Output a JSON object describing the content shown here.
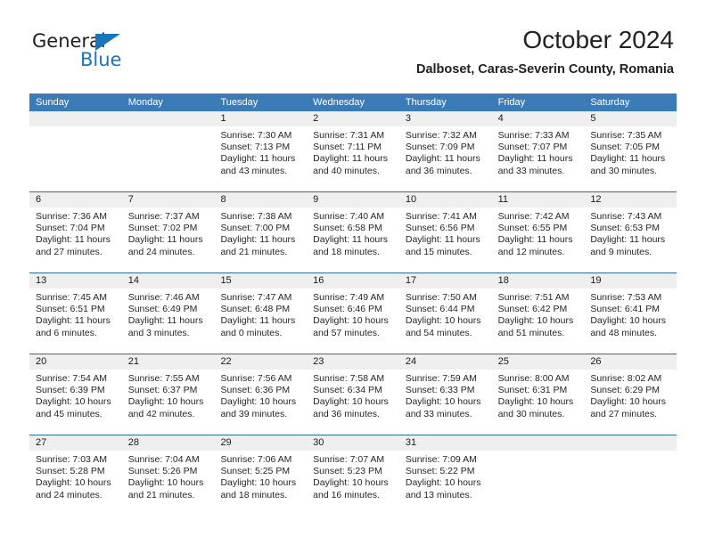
{
  "brand": {
    "name_top": "General",
    "name_bottom": "Blue",
    "accent_color": "#1b75bb"
  },
  "header": {
    "month_title": "October 2024",
    "location": "Dalboset, Caras-Severin County, Romania"
  },
  "calendar": {
    "header_bg": "#3b7cb8",
    "row_divider_color": "#2e6da4",
    "daynum_strip_color": "#efefef",
    "weekdays": [
      "Sunday",
      "Monday",
      "Tuesday",
      "Wednesday",
      "Thursday",
      "Friday",
      "Saturday"
    ],
    "weeks": [
      [
        {
          "day": "",
          "sunrise": "",
          "sunset": "",
          "daylight1": "",
          "daylight2": "",
          "type": "empty"
        },
        {
          "day": "",
          "sunrise": "",
          "sunset": "",
          "daylight1": "",
          "daylight2": "",
          "type": "empty"
        },
        {
          "day": "1",
          "sunrise": "Sunrise: 7:30 AM",
          "sunset": "Sunset: 7:13 PM",
          "daylight1": "Daylight: 11 hours",
          "daylight2": "and 43 minutes.",
          "type": "day"
        },
        {
          "day": "2",
          "sunrise": "Sunrise: 7:31 AM",
          "sunset": "Sunset: 7:11 PM",
          "daylight1": "Daylight: 11 hours",
          "daylight2": "and 40 minutes.",
          "type": "day"
        },
        {
          "day": "3",
          "sunrise": "Sunrise: 7:32 AM",
          "sunset": "Sunset: 7:09 PM",
          "daylight1": "Daylight: 11 hours",
          "daylight2": "and 36 minutes.",
          "type": "day"
        },
        {
          "day": "4",
          "sunrise": "Sunrise: 7:33 AM",
          "sunset": "Sunset: 7:07 PM",
          "daylight1": "Daylight: 11 hours",
          "daylight2": "and 33 minutes.",
          "type": "day"
        },
        {
          "day": "5",
          "sunrise": "Sunrise: 7:35 AM",
          "sunset": "Sunset: 7:05 PM",
          "daylight1": "Daylight: 11 hours",
          "daylight2": "and 30 minutes.",
          "type": "day"
        }
      ],
      [
        {
          "day": "6",
          "sunrise": "Sunrise: 7:36 AM",
          "sunset": "Sunset: 7:04 PM",
          "daylight1": "Daylight: 11 hours",
          "daylight2": "and 27 minutes.",
          "type": "day"
        },
        {
          "day": "7",
          "sunrise": "Sunrise: 7:37 AM",
          "sunset": "Sunset: 7:02 PM",
          "daylight1": "Daylight: 11 hours",
          "daylight2": "and 24 minutes.",
          "type": "day"
        },
        {
          "day": "8",
          "sunrise": "Sunrise: 7:38 AM",
          "sunset": "Sunset: 7:00 PM",
          "daylight1": "Daylight: 11 hours",
          "daylight2": "and 21 minutes.",
          "type": "day"
        },
        {
          "day": "9",
          "sunrise": "Sunrise: 7:40 AM",
          "sunset": "Sunset: 6:58 PM",
          "daylight1": "Daylight: 11 hours",
          "daylight2": "and 18 minutes.",
          "type": "day"
        },
        {
          "day": "10",
          "sunrise": "Sunrise: 7:41 AM",
          "sunset": "Sunset: 6:56 PM",
          "daylight1": "Daylight: 11 hours",
          "daylight2": "and 15 minutes.",
          "type": "day"
        },
        {
          "day": "11",
          "sunrise": "Sunrise: 7:42 AM",
          "sunset": "Sunset: 6:55 PM",
          "daylight1": "Daylight: 11 hours",
          "daylight2": "and 12 minutes.",
          "type": "day"
        },
        {
          "day": "12",
          "sunrise": "Sunrise: 7:43 AM",
          "sunset": "Sunset: 6:53 PM",
          "daylight1": "Daylight: 11 hours",
          "daylight2": "and 9 minutes.",
          "type": "day"
        }
      ],
      [
        {
          "day": "13",
          "sunrise": "Sunrise: 7:45 AM",
          "sunset": "Sunset: 6:51 PM",
          "daylight1": "Daylight: 11 hours",
          "daylight2": "and 6 minutes.",
          "type": "day"
        },
        {
          "day": "14",
          "sunrise": "Sunrise: 7:46 AM",
          "sunset": "Sunset: 6:49 PM",
          "daylight1": "Daylight: 11 hours",
          "daylight2": "and 3 minutes.",
          "type": "day"
        },
        {
          "day": "15",
          "sunrise": "Sunrise: 7:47 AM",
          "sunset": "Sunset: 6:48 PM",
          "daylight1": "Daylight: 11 hours",
          "daylight2": "and 0 minutes.",
          "type": "day"
        },
        {
          "day": "16",
          "sunrise": "Sunrise: 7:49 AM",
          "sunset": "Sunset: 6:46 PM",
          "daylight1": "Daylight: 10 hours",
          "daylight2": "and 57 minutes.",
          "type": "day"
        },
        {
          "day": "17",
          "sunrise": "Sunrise: 7:50 AM",
          "sunset": "Sunset: 6:44 PM",
          "daylight1": "Daylight: 10 hours",
          "daylight2": "and 54 minutes.",
          "type": "day"
        },
        {
          "day": "18",
          "sunrise": "Sunrise: 7:51 AM",
          "sunset": "Sunset: 6:42 PM",
          "daylight1": "Daylight: 10 hours",
          "daylight2": "and 51 minutes.",
          "type": "day"
        },
        {
          "day": "19",
          "sunrise": "Sunrise: 7:53 AM",
          "sunset": "Sunset: 6:41 PM",
          "daylight1": "Daylight: 10 hours",
          "daylight2": "and 48 minutes.",
          "type": "day"
        }
      ],
      [
        {
          "day": "20",
          "sunrise": "Sunrise: 7:54 AM",
          "sunset": "Sunset: 6:39 PM",
          "daylight1": "Daylight: 10 hours",
          "daylight2": "and 45 minutes.",
          "type": "day"
        },
        {
          "day": "21",
          "sunrise": "Sunrise: 7:55 AM",
          "sunset": "Sunset: 6:37 PM",
          "daylight1": "Daylight: 10 hours",
          "daylight2": "and 42 minutes.",
          "type": "day"
        },
        {
          "day": "22",
          "sunrise": "Sunrise: 7:56 AM",
          "sunset": "Sunset: 6:36 PM",
          "daylight1": "Daylight: 10 hours",
          "daylight2": "and 39 minutes.",
          "type": "day"
        },
        {
          "day": "23",
          "sunrise": "Sunrise: 7:58 AM",
          "sunset": "Sunset: 6:34 PM",
          "daylight1": "Daylight: 10 hours",
          "daylight2": "and 36 minutes.",
          "type": "day"
        },
        {
          "day": "24",
          "sunrise": "Sunrise: 7:59 AM",
          "sunset": "Sunset: 6:33 PM",
          "daylight1": "Daylight: 10 hours",
          "daylight2": "and 33 minutes.",
          "type": "day"
        },
        {
          "day": "25",
          "sunrise": "Sunrise: 8:00 AM",
          "sunset": "Sunset: 6:31 PM",
          "daylight1": "Daylight: 10 hours",
          "daylight2": "and 30 minutes.",
          "type": "day"
        },
        {
          "day": "26",
          "sunrise": "Sunrise: 8:02 AM",
          "sunset": "Sunset: 6:29 PM",
          "daylight1": "Daylight: 10 hours",
          "daylight2": "and 27 minutes.",
          "type": "day"
        }
      ],
      [
        {
          "day": "27",
          "sunrise": "Sunrise: 7:03 AM",
          "sunset": "Sunset: 5:28 PM",
          "daylight1": "Daylight: 10 hours",
          "daylight2": "and 24 minutes.",
          "type": "day"
        },
        {
          "day": "28",
          "sunrise": "Sunrise: 7:04 AM",
          "sunset": "Sunset: 5:26 PM",
          "daylight1": "Daylight: 10 hours",
          "daylight2": "and 21 minutes.",
          "type": "day"
        },
        {
          "day": "29",
          "sunrise": "Sunrise: 7:06 AM",
          "sunset": "Sunset: 5:25 PM",
          "daylight1": "Daylight: 10 hours",
          "daylight2": "and 18 minutes.",
          "type": "day"
        },
        {
          "day": "30",
          "sunrise": "Sunrise: 7:07 AM",
          "sunset": "Sunset: 5:23 PM",
          "daylight1": "Daylight: 10 hours",
          "daylight2": "and 16 minutes.",
          "type": "day"
        },
        {
          "day": "31",
          "sunrise": "Sunrise: 7:09 AM",
          "sunset": "Sunset: 5:22 PM",
          "daylight1": "Daylight: 10 hours",
          "daylight2": "and 13 minutes.",
          "type": "day"
        },
        {
          "day": "",
          "sunrise": "",
          "sunset": "",
          "daylight1": "",
          "daylight2": "",
          "type": "empty"
        },
        {
          "day": "",
          "sunrise": "",
          "sunset": "",
          "daylight1": "",
          "daylight2": "",
          "type": "empty"
        }
      ]
    ]
  }
}
